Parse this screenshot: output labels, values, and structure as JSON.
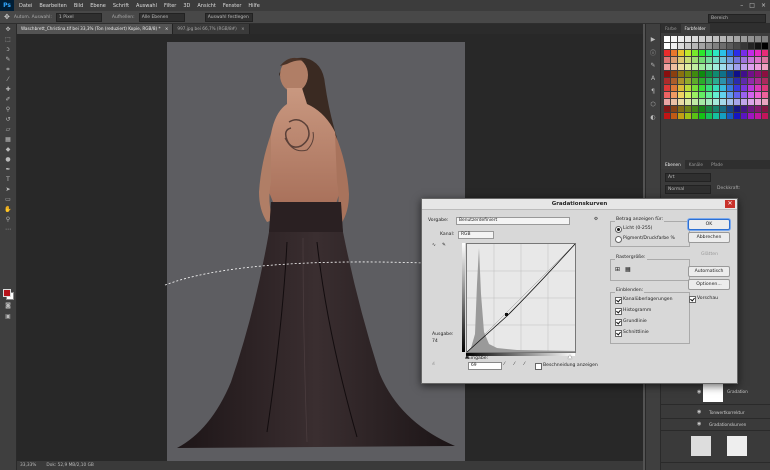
{
  "app": {
    "logo": "Ps"
  },
  "menubar": {
    "items": [
      "Datei",
      "Bearbeiten",
      "Bild",
      "Ebene",
      "Schrift",
      "Auswahl",
      "Filter",
      "3D",
      "Ansicht",
      "Fenster",
      "Hilfe"
    ],
    "min": "–",
    "max": "□",
    "close": "×"
  },
  "options": {
    "auto_select_label": "Autom. Auswahl:",
    "auto_select_value": "1 Pixel",
    "tolerance_label": "Aufhellen:",
    "tolerance_value": "Alle Ebenen",
    "sample_label": "Auswahl festlegen",
    "search_placeholder": "Bereich"
  },
  "tabs": [
    {
      "label": "Waschbrett_Christina.tif bei 33,3% (Ton (reduziert) Kopie, RGB/8) *",
      "close": "×"
    },
    {
      "label": "997.jpg bei 66,7% (RGB/8#)",
      "close": "×"
    }
  ],
  "status": {
    "zoom": "33,33%",
    "doc": "Dok: 52,9 MB/2,10 GB"
  },
  "swatches_panel": {
    "tabs": [
      "Farbe",
      "Farbfelder"
    ]
  },
  "layers_panel": {
    "tabs": [
      "Ebenen",
      "Kanäle",
      "Pfade"
    ],
    "kind_label": "Art",
    "mode_value": "Normal",
    "opacity_label": "Deckkraft:",
    "layers": [
      {
        "name": "Gradation"
      },
      {
        "name": "Tonwertkorrektur"
      },
      {
        "name": "Gradationskurven"
      }
    ]
  },
  "dialog": {
    "title": "Gradationskurven",
    "close": "✕",
    "preset_label": "Vorgabe:",
    "preset_value": "Benutzerdefiniert",
    "channel_label": "Kanal:",
    "channel_value": "RGB",
    "output_label": "Ausgabe:",
    "output_value": "74",
    "input_label": "Eingabe:",
    "input_value": "69",
    "clip_label": "Beschneidung anzeigen",
    "show_amount_label": "Betrag anzeigen für:",
    "light_label": "Licht (0-255)",
    "pigment_label": "Pigment/Druckfarbe %",
    "grid_label": "Rastergröße:",
    "show_label": "Einblenden:",
    "checks": [
      "Kanalüberlagerungen",
      "Histogramm",
      "Grundlinie",
      "Schnittlinie"
    ],
    "ok": "OK",
    "cancel": "Abbrechen",
    "smooth": "Glätten",
    "auto": "Automatisch",
    "options": "Optionen...",
    "preview": "Vorschau"
  }
}
